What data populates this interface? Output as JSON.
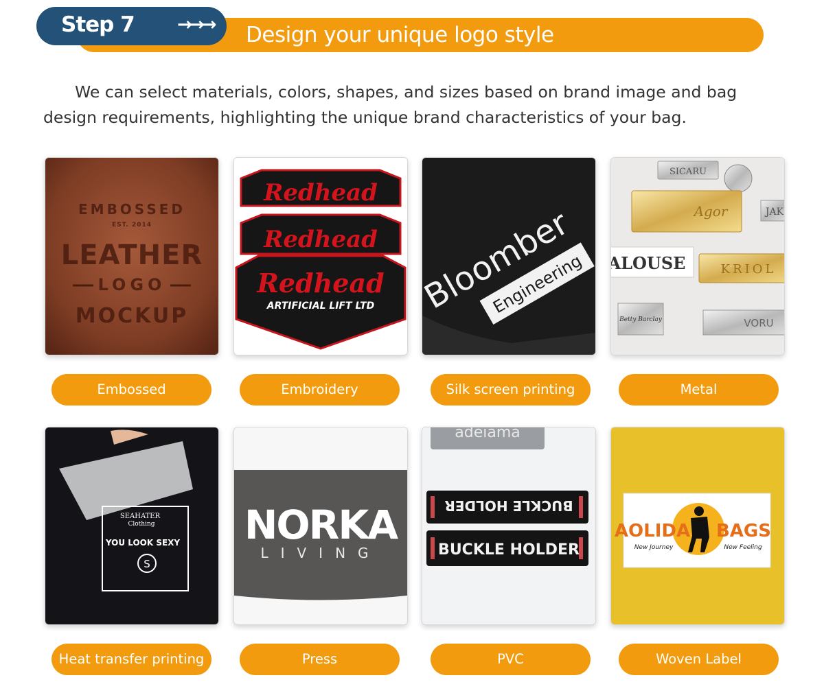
{
  "header": {
    "step_label": "Step 7",
    "arrows": "→→→",
    "title": "Design your unique logo style"
  },
  "intro": "We can select materials, colors, shapes, and sizes based on brand image and bag design requirements, highlighting the unique brand characteristics of your bag.",
  "colors": {
    "accent_orange": "#f29b0e",
    "step_navy": "#235177"
  },
  "cards": [
    {
      "label": "Embossed",
      "image_text": [
        "EMBOSSED",
        "EST. 2014",
        "LEATHER",
        "LOGO",
        "MOCKUP"
      ]
    },
    {
      "label": "Embroidery",
      "image_text": [
        "Redhead",
        "Redhead",
        "Redhead",
        "ARTIFICIAL LIFT LTD"
      ]
    },
    {
      "label": "Silk screen printing",
      "image_text": [
        "Bloomber",
        "Engineering"
      ]
    },
    {
      "label": "Metal",
      "image_text": [
        "SICARU",
        "Agor",
        "ALOUSE",
        "KRIOL",
        "JAK",
        "Betty Barclay",
        "VORU"
      ]
    },
    {
      "label": "Heat transfer printing",
      "image_text": [
        "SEAHATER",
        "Clothing",
        "YOU LOOK SEXY",
        "S"
      ]
    },
    {
      "label": "Press",
      "image_text": [
        "NORKA",
        "LIVING"
      ]
    },
    {
      "label": "PVC",
      "image_text": [
        "BUCKLE HOLDER",
        "BUCKLE HOLDER",
        "adeiama"
      ]
    },
    {
      "label": "Woven Label",
      "image_text": [
        "AOLIDA",
        "BAGS",
        "New Journey",
        "New Feeling"
      ]
    }
  ]
}
